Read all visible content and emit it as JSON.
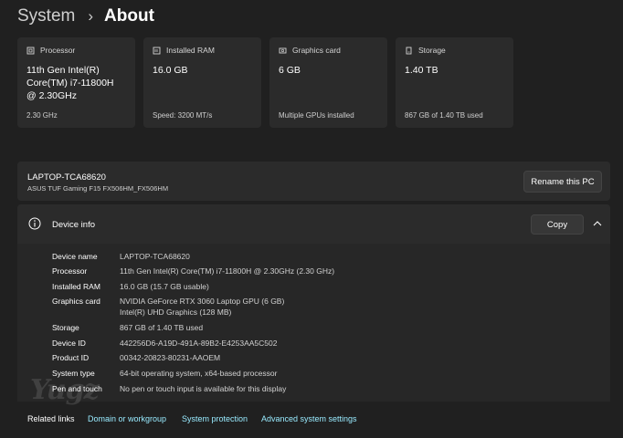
{
  "breadcrumb": {
    "root": "System",
    "separator": "›",
    "page": "About"
  },
  "cards": [
    {
      "title": "Processor",
      "value": "11th Gen Intel(R) Core(TM) i7-11800H @ 2.30GHz",
      "sub": "2.30 GHz",
      "icon": "processor-icon"
    },
    {
      "title": "Installed RAM",
      "value": "16.0 GB",
      "sub": "Speed: 3200 MT/s",
      "icon": "ram-icon"
    },
    {
      "title": "Graphics card",
      "value": "6 GB",
      "sub": "Multiple GPUs installed",
      "icon": "graphics-card-icon"
    },
    {
      "title": "Storage",
      "value": "1.40 TB",
      "sub": "867 GB of 1.40 TB used",
      "icon": "storage-icon"
    }
  ],
  "pc": {
    "name": "LAPTOP-TCA68620",
    "model": "ASUS TUF Gaming F15 FX506HM_FX506HM",
    "rename_label": "Rename this PC"
  },
  "device_info": {
    "title": "Device info",
    "copy_label": "Copy",
    "specs": [
      {
        "label": "Device name",
        "value": "LAPTOP-TCA68620"
      },
      {
        "label": "Processor",
        "value": "11th Gen Intel(R) Core(TM) i7-11800H @ 2.30GHz (2.30 GHz)"
      },
      {
        "label": "Installed RAM",
        "value": "16.0 GB (15.7 GB usable)"
      },
      {
        "label": "Graphics card",
        "value": "NVIDIA GeForce RTX 3060 Laptop GPU (6 GB)",
        "value2": "Intel(R) UHD Graphics (128 MB)"
      },
      {
        "label": "Storage",
        "value": "867 GB of 1.40 TB used"
      },
      {
        "label": "Device ID",
        "value": "442256D6-A19D-491A-89B2-E4253AA5C502"
      },
      {
        "label": "Product ID",
        "value": "00342-20823-80231-AAOEM"
      },
      {
        "label": "System type",
        "value": "64-bit operating system, x64-based processor"
      },
      {
        "label": "Pen and touch",
        "value": "No pen or touch input is available for this display"
      }
    ]
  },
  "related": {
    "label": "Related links",
    "links": [
      "Domain or workgroup",
      "System protection",
      "Advanced system settings"
    ]
  },
  "watermark": "Yugz",
  "colors": {
    "background": "#202020",
    "card": "#2b2b2b",
    "link": "#99ebff"
  }
}
